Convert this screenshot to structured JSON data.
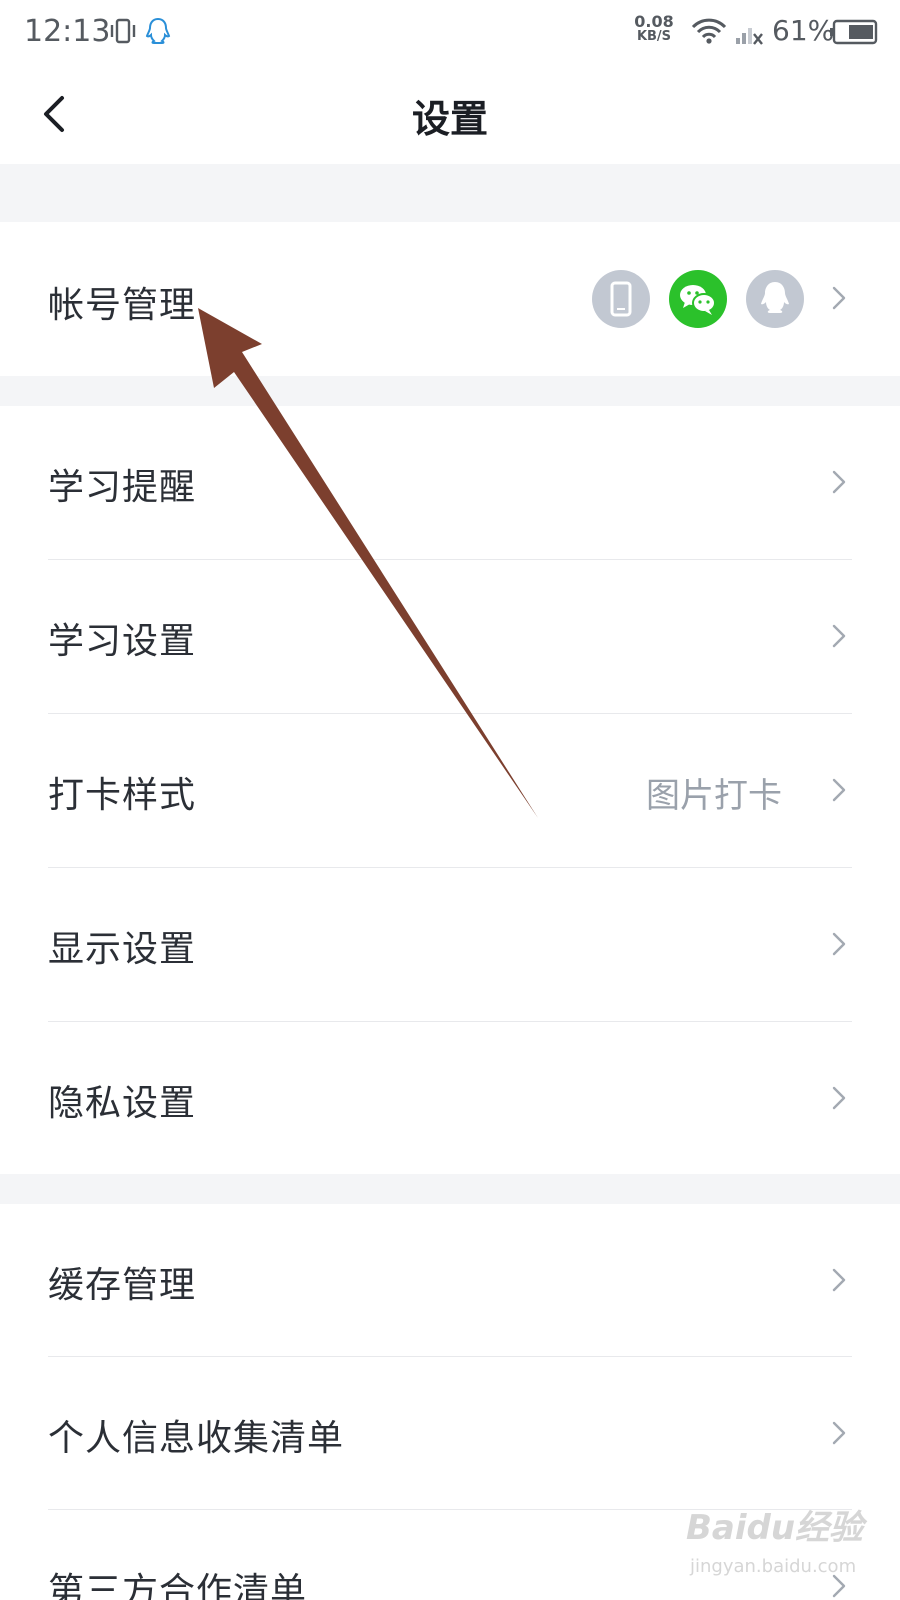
{
  "status_bar": {
    "time": "12:13",
    "net_speed_value": "0.08",
    "net_speed_unit": "KB/S",
    "battery": "61%"
  },
  "header": {
    "title": "设置",
    "back_icon": "chevron-left-icon"
  },
  "sections": [
    {
      "items": [
        {
          "label": "帐号管理",
          "linked_accounts": [
            "phone-icon",
            "wechat-icon",
            "qq-icon"
          ]
        }
      ]
    },
    {
      "items": [
        {
          "label": "学习提醒"
        },
        {
          "label": "学习设置"
        },
        {
          "label": "打卡样式",
          "value": "图片打卡"
        },
        {
          "label": "显示设置"
        },
        {
          "label": "隐私设置"
        }
      ]
    },
    {
      "items": [
        {
          "label": "缓存管理"
        },
        {
          "label": "个人信息收集清单"
        },
        {
          "label": "第三方合作清单"
        }
      ]
    }
  ],
  "colors": {
    "wechat_green": "#2bc12b",
    "account_icon_gray": "#c2c8d2",
    "annotation_arrow": "#7c3f2e",
    "section_gap": "#f4f5f7"
  },
  "watermark": {
    "main": "Baidu经验",
    "sub": "jingyan.baidu.com"
  }
}
